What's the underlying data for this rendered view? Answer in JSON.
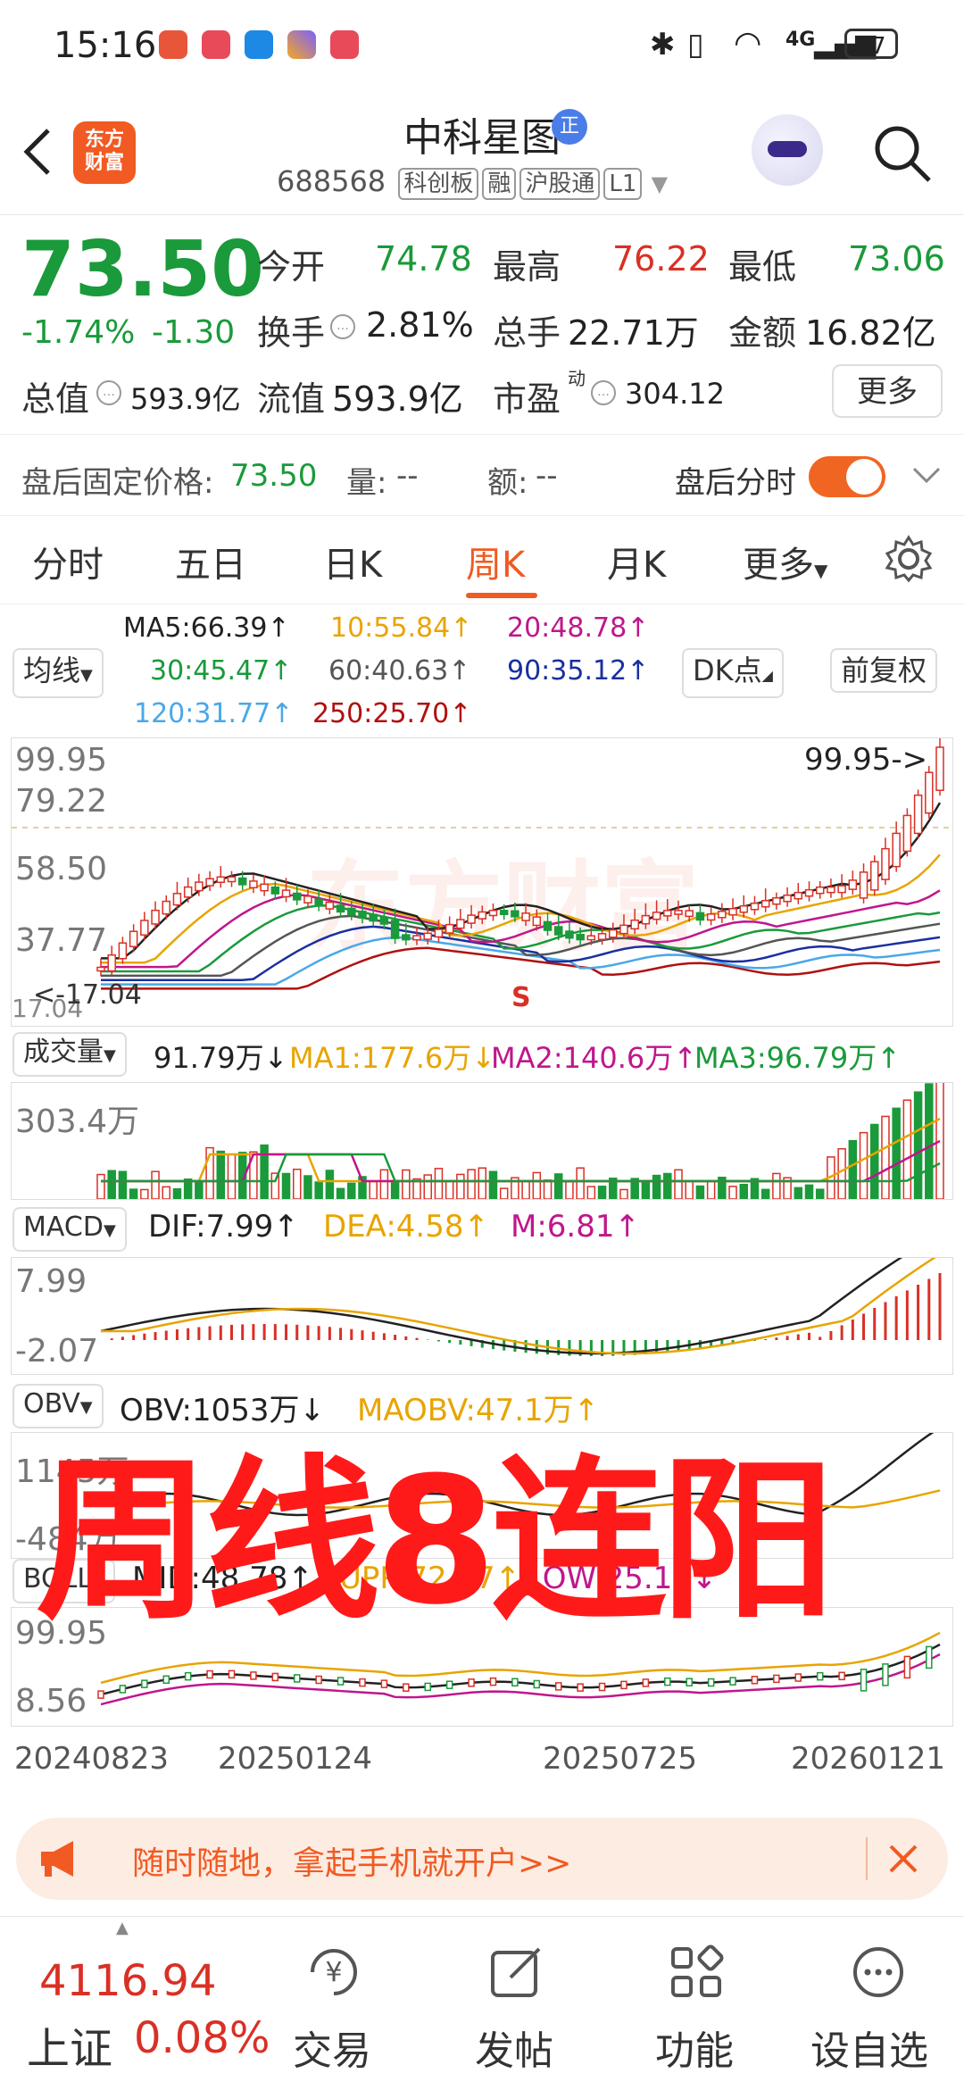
{
  "status_bar": {
    "time": "15:16",
    "battery": "67",
    "network": "4G"
  },
  "header": {
    "stock_name": "中科星图",
    "name_badge": "正",
    "code": "688568",
    "tags": [
      "科创板",
      "融",
      "沪股通",
      "L1"
    ],
    "logo_text": "东方财富"
  },
  "quote": {
    "price": "73.50",
    "change_pct": "-1.74%",
    "change": "-1.30",
    "open_label": "今开",
    "open": "74.78",
    "high_label": "最高",
    "high": "76.22",
    "low_label": "最低",
    "low": "73.06",
    "turnover_label": "换手",
    "turnover": "2.81%",
    "volume_label": "总手",
    "volume": "22.71万",
    "amount_label": "金额",
    "amount": "16.82亿",
    "mktcap_label": "总值",
    "mktcap": "593.9亿",
    "float_label": "流值",
    "float": "593.9亿",
    "pe_label": "市盈",
    "pe_sup": "动",
    "pe": "304.12",
    "more_label": "更多"
  },
  "after_hours": {
    "price_label": "盘后固定价格:",
    "price": "73.50",
    "vol_label": "量:",
    "vol": "--",
    "amt_label": "额:",
    "amt": "--",
    "toggle_label": "盘后分时"
  },
  "tabs": [
    "分时",
    "五日",
    "日K",
    "周K",
    "月K",
    "更多"
  ],
  "ma": {
    "selector": "均线",
    "ma5": "MA5:66.39↑",
    "ma10": "10:55.84↑",
    "ma20": "20:48.78↑",
    "ma30": "30:45.47↑",
    "ma60": "60:40.63↑",
    "ma90": "90:35.12↑",
    "ma120": "120:31.77↑",
    "ma250": "250:25.70↑",
    "dk_label": "DK点",
    "adjust_label": "前复权",
    "colors": {
      "ma5": "#222222",
      "ma10": "#e8a400",
      "ma20": "#c0168c",
      "ma30": "#1a9a3a",
      "ma60": "#555555",
      "ma90": "#1a2fa0",
      "ma120": "#4aa8e8",
      "ma250": "#b01010"
    }
  },
  "kline": {
    "top": "99.95",
    "l1": "79.22",
    "l2": "58.50",
    "l3": "37.77",
    "bottom": "17.04",
    "marker": "99.95->",
    "low_marker": "<-17.04"
  },
  "volume": {
    "selector": "成交量",
    "value": "91.79万↓",
    "ma1": "MA1:177.6万↓",
    "ma2": "MA2:140.6万↑",
    "ma3": "MA3:96.79万↑",
    "axis": "303.4万"
  },
  "macd": {
    "selector": "MACD",
    "dif": "DIF:7.99↑",
    "dea": "DEA:4.58↑",
    "m": "M:6.81↑",
    "top": "7.99",
    "bottom": "-2.07"
  },
  "obv": {
    "selector": "OBV",
    "obv": "OBV:1053万↓",
    "maobv": "MAOBV:47.1万↑",
    "top": "1145万",
    "bottom": "-484万"
  },
  "boll": {
    "selector": "BOLL",
    "mid": "MID:48.78↑",
    "upp": "UPP:72.37↑",
    "low": "LOW:25.19↓",
    "top": "99.95",
    "bottom": "8.56"
  },
  "dates": [
    "20240823",
    "20250124",
    "20250725",
    "20260121"
  ],
  "overlay_text": "周线8连阳",
  "banner": {
    "text": "随时随地，拿起手机就开户>>"
  },
  "bottom_nav": {
    "index_value": "4116.94",
    "index_name": "上证",
    "index_change": "0.08%",
    "items": [
      "交易",
      "发帖",
      "功能",
      "设自选"
    ]
  }
}
